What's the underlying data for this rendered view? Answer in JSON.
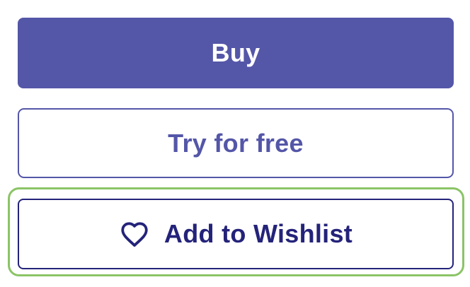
{
  "colors": {
    "primary": "#5456A8",
    "primary_text": "#5456A8",
    "on_primary": "#FFFFFF",
    "outline_light": "#5456A8",
    "wishlist_text": "#24237A",
    "wishlist_border": "#24237A",
    "focus_ring": "#8BC466"
  },
  "actions": {
    "buy_label": "Buy",
    "try_label": "Try for free",
    "wishlist_label": "Add to Wishlist",
    "wishlist_icon": "heart-outline-icon"
  }
}
